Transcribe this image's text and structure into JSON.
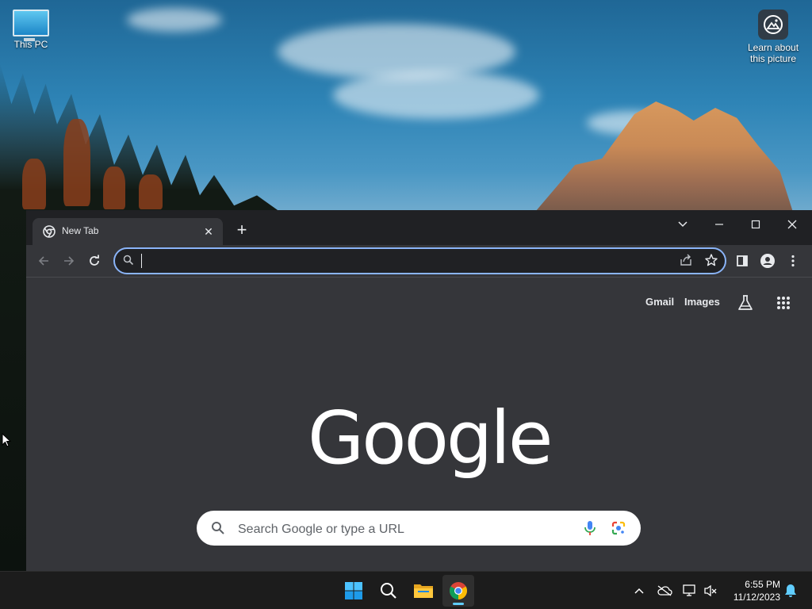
{
  "desktop": {
    "icons": [
      {
        "label": "This PC",
        "icon": "monitor-icon"
      },
      {
        "label": "Learn about this picture",
        "line1": "Learn about",
        "line2": "this picture",
        "icon": "camera-info-icon"
      }
    ]
  },
  "browser": {
    "tab": {
      "title": "New Tab",
      "favicon": "chrome-icon",
      "close": "✕"
    },
    "new_tab": "+",
    "window_controls": [
      "tab-search",
      "minimize",
      "maximize",
      "close"
    ],
    "omnibox": {
      "value": "",
      "placeholder": ""
    },
    "toolbar_icons": [
      "back-icon",
      "forward-icon",
      "reload-icon",
      "share-icon",
      "bookmark-star-icon",
      "side-panel-icon",
      "profile-icon",
      "menu-icon"
    ],
    "ntp": {
      "gmail": "Gmail",
      "images": "Images",
      "logo": "Google",
      "search_placeholder": "Search Google or type a URL"
    }
  },
  "taskbar": {
    "apps": [
      "windows-start-icon",
      "search-icon",
      "file-explorer-icon",
      "chrome-icon"
    ],
    "time": "6:55 PM",
    "date": "11/12/2023",
    "colors": {
      "accent": "#60cdff",
      "omnibox_focus": "#8ab4f8"
    }
  }
}
